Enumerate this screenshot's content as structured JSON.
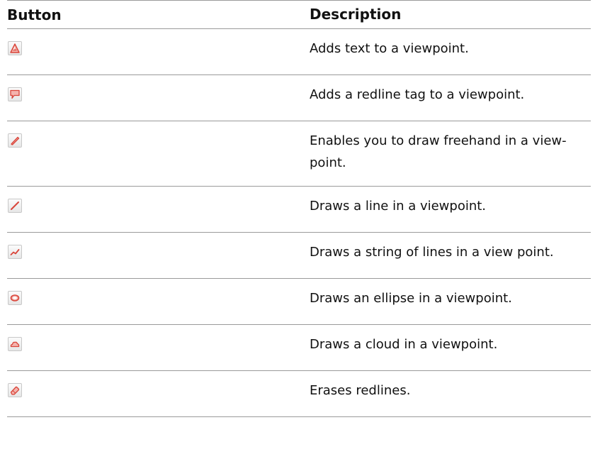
{
  "table": {
    "headers": {
      "button": "Button",
      "description": "Description"
    },
    "rows": [
      {
        "icon": "redline-text-icon",
        "description": "Adds text to a viewpoint."
      },
      {
        "icon": "redline-tag-icon",
        "description": "Adds a redline tag to a viewpoint."
      },
      {
        "icon": "freehand-pencil-icon",
        "description": "Enables you to draw freehand in a view-point."
      },
      {
        "icon": "draw-line-icon",
        "description": "Draws a line in a viewpoint."
      },
      {
        "icon": "line-string-icon",
        "description": "Draws a string of lines in a view point."
      },
      {
        "icon": "ellipse-icon",
        "description": "Draws an ellipse in a viewpoint."
      },
      {
        "icon": "cloud-icon",
        "description": "Draws a cloud in a viewpoint."
      },
      {
        "icon": "eraser-icon",
        "description": "Erases redlines."
      }
    ]
  },
  "colors": {
    "icon_red": "#d9453a",
    "icon_pink": "#f4b3ad",
    "rule": "#9a9a9a"
  }
}
